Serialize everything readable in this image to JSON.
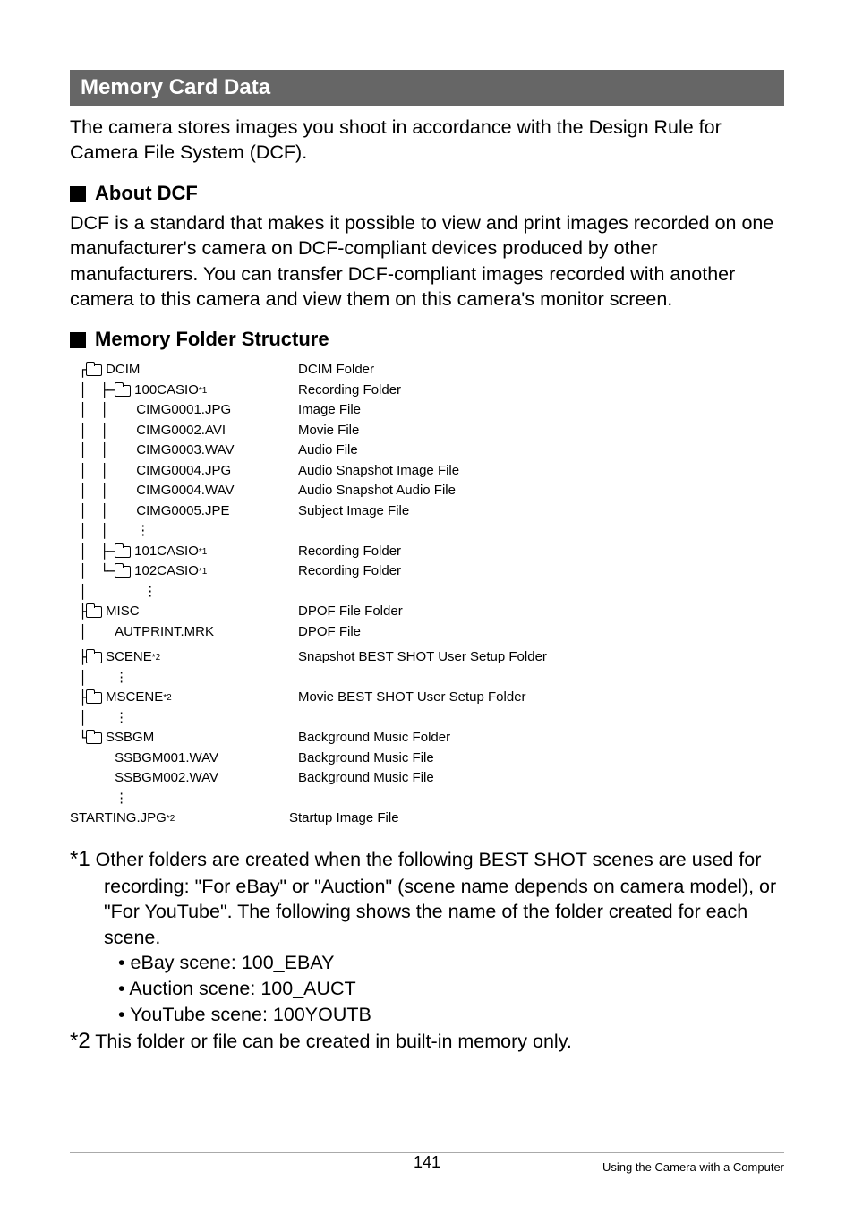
{
  "section": {
    "title": "Memory Card Data"
  },
  "intro": "The camera stores images you shoot in accordance with the Design Rule for Camera File System (DCF).",
  "about": {
    "heading": "About DCF",
    "body": "DCF is a standard that makes it possible to view and print images recorded on one manufacturer's camera on DCF-compliant devices produced by other manufacturers. You can transfer DCF-compliant images recorded with another camera to this camera and view them on this camera's monitor screen."
  },
  "structure": {
    "heading": "Memory Folder Structure"
  },
  "tree": {
    "dcim": {
      "name": "DCIM",
      "desc": "DCIM Folder"
    },
    "f100": {
      "name": "100CASIO",
      "sup": "*1",
      "desc": "Recording Folder"
    },
    "c1": {
      "name": "CIMG0001.JPG",
      "desc": "Image File"
    },
    "c2": {
      "name": "CIMG0002.AVI",
      "desc": "Movie File"
    },
    "c3": {
      "name": "CIMG0003.WAV",
      "desc": "Audio File"
    },
    "c4": {
      "name": "CIMG0004.JPG",
      "desc": "Audio Snapshot Image File"
    },
    "c5": {
      "name": "CIMG0004.WAV",
      "desc": "Audio Snapshot Audio File"
    },
    "c6": {
      "name": "CIMG0005.JPE",
      "desc": "Subject Image File"
    },
    "f101": {
      "name": "101CASIO",
      "sup": "*1",
      "desc": "Recording Folder"
    },
    "f102": {
      "name": "102CASIO",
      "sup": "*1",
      "desc": "Recording Folder"
    },
    "misc": {
      "name": "MISC",
      "desc": "DPOF File Folder"
    },
    "autprint": {
      "name": "AUTPRINT.MRK",
      "desc": "DPOF File"
    },
    "scene": {
      "name": "SCENE",
      "sup": "*2",
      "desc": "Snapshot BEST SHOT User Setup Folder"
    },
    "mscene": {
      "name": "MSCENE",
      "sup": "*2",
      "desc": "Movie BEST SHOT User Setup Folder"
    },
    "ssbgm": {
      "name": "SSBGM",
      "desc": "Background Music Folder"
    },
    "ss1": {
      "name": "SSBGM001.WAV",
      "desc": "Background Music File"
    },
    "ss2": {
      "name": "SSBGM002.WAV",
      "desc": "Background Music File"
    },
    "starting": {
      "name": "STARTING.JPG",
      "sup": "*2",
      "desc": "Startup Image File"
    }
  },
  "footnotes": {
    "f1_lead": "*1",
    "f1": "Other folders are created when the following BEST SHOT scenes are used for recording: \"For eBay\" or \"Auction\" (scene name depends on camera model), or \"For YouTube\". The following shows the name of the folder created for each scene.",
    "b1": "eBay scene: 100_EBAY",
    "b2": "Auction scene: 100_AUCT",
    "b3": "YouTube scene: 100YOUTB",
    "f2_lead": "*2",
    "f2": "This folder or file can be created in built-in memory only."
  },
  "footer": {
    "page": "141",
    "right": "Using the Camera with a Computer"
  }
}
